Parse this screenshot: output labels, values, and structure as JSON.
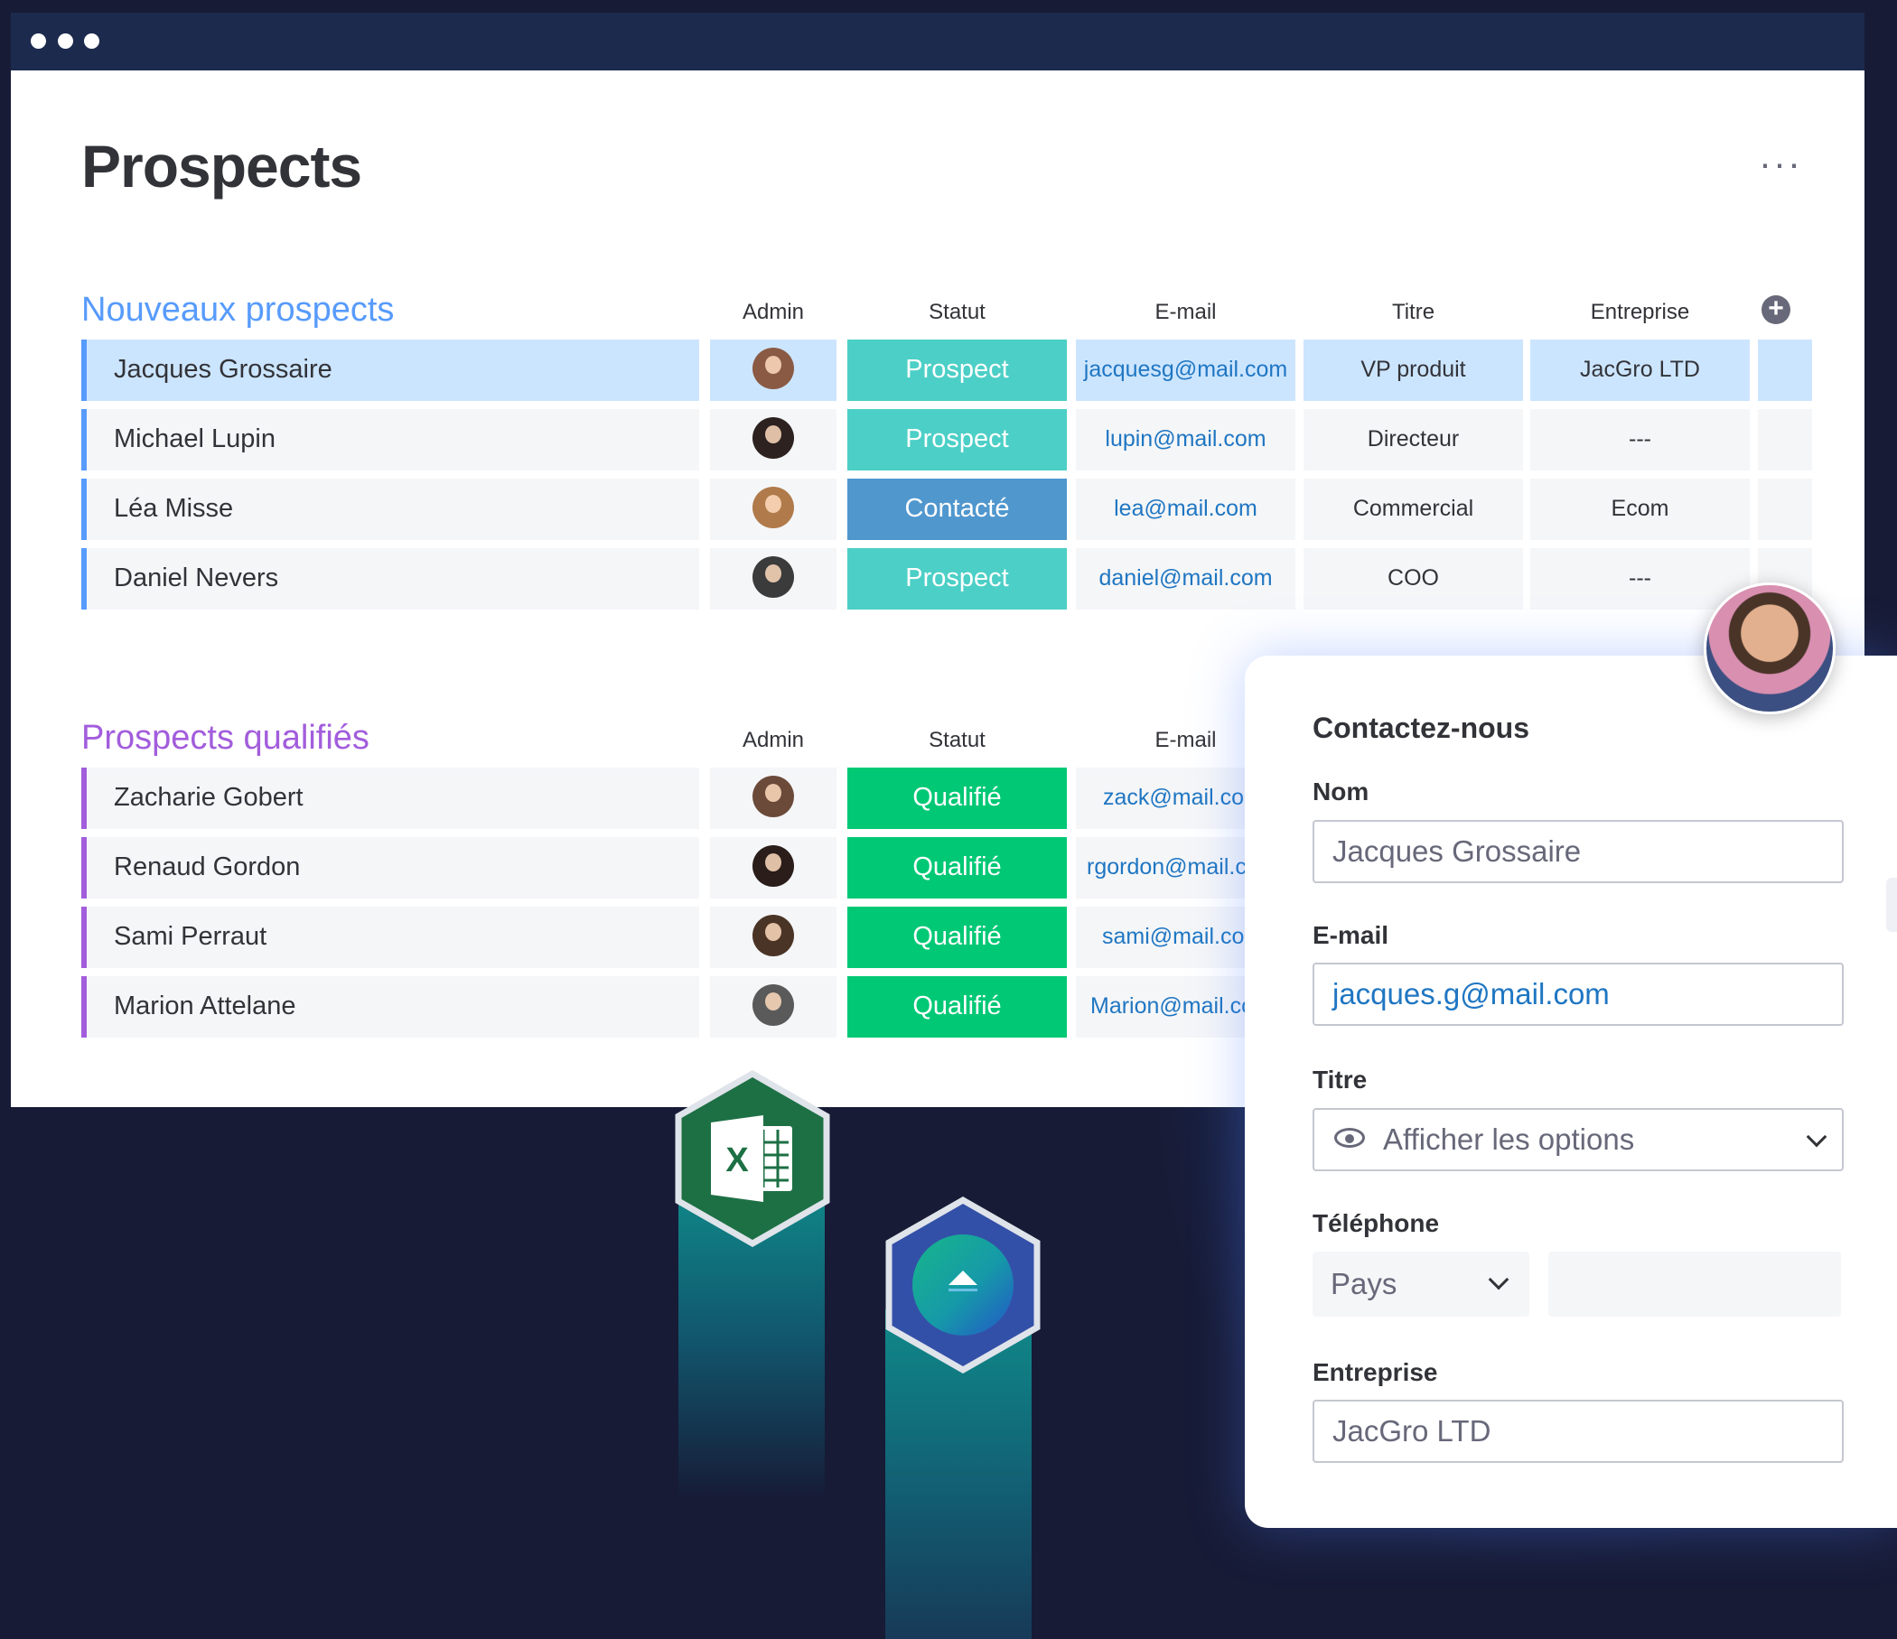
{
  "page": {
    "title": "Prospects",
    "more_label": "···"
  },
  "colors": {
    "group1": "#579bfc",
    "group2": "#a25ddc",
    "prospect": "#4ccfc6",
    "contacte": "#5097ce",
    "qualifie": "#00c875",
    "link": "#1f76c2"
  },
  "group1": {
    "title": "Nouveaux prospects",
    "columns": {
      "admin": "Admin",
      "statut": "Statut",
      "email": "E-mail",
      "titre": "Titre",
      "entreprise": "Entreprise"
    },
    "rows": [
      {
        "name": "Jacques Grossaire",
        "status": "Prospect",
        "email": "jacquesg@mail.com",
        "titre": "VP produit",
        "entreprise": "JacGro LTD"
      },
      {
        "name": "Michael Lupin",
        "status": "Prospect",
        "email": "lupin@mail.com",
        "titre": "Directeur",
        "entreprise": "---"
      },
      {
        "name": "Léa Misse",
        "status": "Contacté",
        "email": "lea@mail.com",
        "titre": "Commercial",
        "entreprise": "Ecom"
      },
      {
        "name": "Daniel Nevers",
        "status": "Prospect",
        "email": "daniel@mail.com",
        "titre": "COO",
        "entreprise": "---"
      }
    ]
  },
  "group2": {
    "title": "Prospects qualifiés",
    "columns": {
      "admin": "Admin",
      "statut": "Statut",
      "email": "E-mail"
    },
    "rows": [
      {
        "name": "Zacharie Gobert",
        "status": "Qualifié",
        "email": "zack@mail.com"
      },
      {
        "name": "Renaud Gordon",
        "status": "Qualifié",
        "email": "rgordon@mail.com"
      },
      {
        "name": "Sami Perraut",
        "status": "Qualifié",
        "email": "sami@mail.com"
      },
      {
        "name": "Marion Attelane",
        "status": "Qualifié",
        "email": "Marion@mail.com"
      }
    ]
  },
  "form": {
    "title": "Contactez-nous",
    "nom_label": "Nom",
    "nom_value": "Jacques Grossaire",
    "email_label": "E-mail",
    "email_value": "jacques.g@mail.com",
    "titre_label": "Titre",
    "titre_placeholder": "Afficher les options",
    "telephone_label": "Téléphone",
    "pays_label": "Pays",
    "entreprise_label": "Entreprise",
    "entreprise_value": "JacGro LTD"
  },
  "icons": {
    "excel": "excel-icon",
    "app2": "integration-app-icon"
  }
}
